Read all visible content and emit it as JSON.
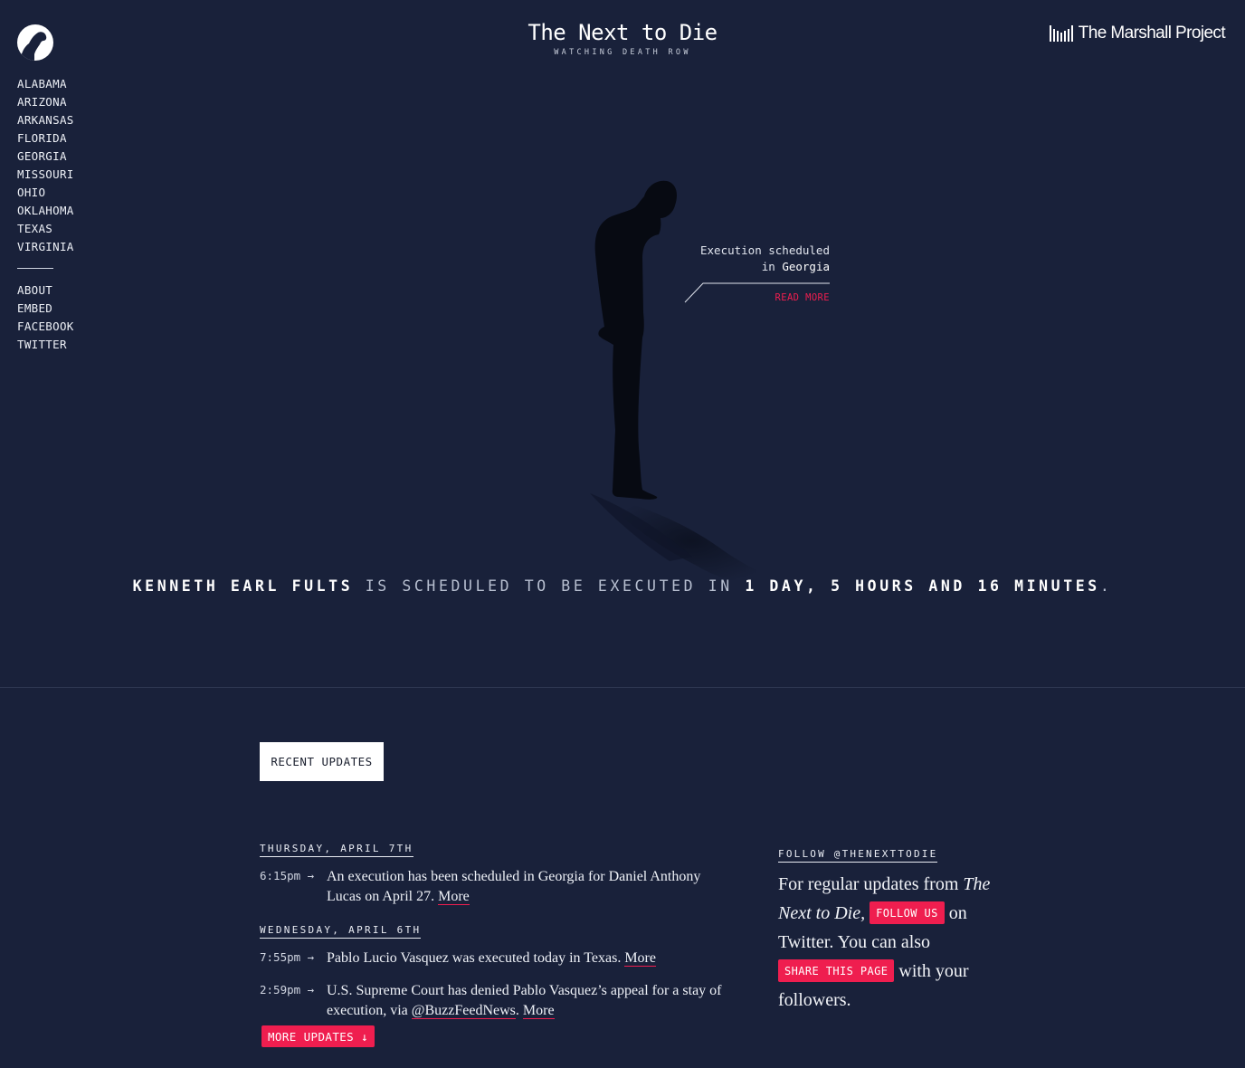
{
  "header": {
    "title": "The Next to Die",
    "subtitle": "WATCHING DEATH ROW",
    "publisher": "The Marshall Project"
  },
  "nav": {
    "states": [
      "ALABAMA",
      "ARIZONA",
      "ARKANSAS",
      "FLORIDA",
      "GEORGIA",
      "MISSOURI",
      "OHIO",
      "OKLAHOMA",
      "TEXAS",
      "VIRGINIA"
    ],
    "links": [
      "ABOUT",
      "EMBED",
      "FACEBOOK",
      "TWITTER"
    ]
  },
  "callout": {
    "line1": "Execution scheduled",
    "line2_prefix": "in",
    "state": "Georgia",
    "read_more": "READ MORE"
  },
  "countdown": {
    "name": "KENNETH EARL FULTS",
    "middle": " IS SCHEDULED TO BE EXECUTED IN ",
    "time": "1 DAY, 5 HOURS AND 16 MINUTES",
    "end": "."
  },
  "tabs": {
    "recent": "RECENT UPDATES"
  },
  "updates": [
    {
      "date": "THURSDAY, APRIL 7TH",
      "items": [
        {
          "time": "6:15pm →",
          "text": "An execution has been scheduled in Georgia for Daniel Anthony Lucas on April 27. ",
          "more": "More"
        }
      ]
    },
    {
      "date": "WEDNESDAY, APRIL 6TH",
      "items": [
        {
          "time": "7:55pm →",
          "text": "Pablo Lucio Vasquez was executed today in Texas. ",
          "more": "More"
        },
        {
          "time": "2:59pm →",
          "text": "U.S. Supreme Court has denied Pablo Vasquez’s appeal for a stay of execution, via ",
          "link": "@BuzzFeedNews",
          "after": ". ",
          "more": "More"
        }
      ]
    }
  ],
  "more_updates": "MORE UPDATES ↓",
  "follow": {
    "heading": "FOLLOW @THENEXTTODIE",
    "text1": "For regular updates from ",
    "italic": "The Next to Die,",
    "follow_btn": "FOLLOW US",
    "text2": " on Twitter. You can also ",
    "share_btn": "SHARE THIS PAGE",
    "text3": " with your followers."
  },
  "colors": {
    "background": "#19213a",
    "accent": "#ef1e4f",
    "text": "#e9ecf3"
  }
}
